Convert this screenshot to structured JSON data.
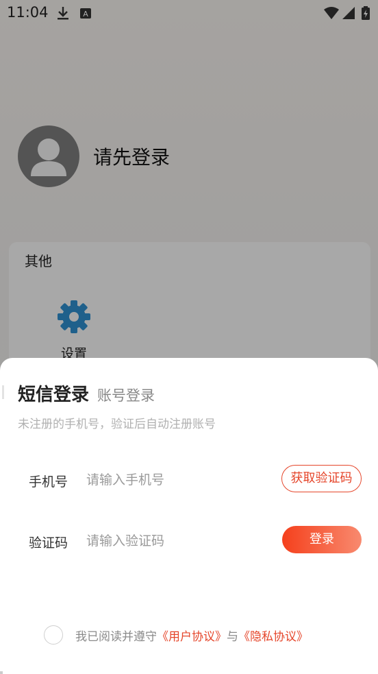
{
  "status_bar": {
    "time": "11:04",
    "icons": [
      "download-icon",
      "a-box-icon",
      "wifi-icon",
      "signal-icon",
      "battery-charging-icon"
    ]
  },
  "profile": {
    "name": "请先登录"
  },
  "other_section": {
    "title": "其他",
    "items": [
      {
        "label": "设置",
        "icon": "gear-icon"
      }
    ]
  },
  "login_sheet": {
    "tab_sms": "短信登录",
    "tab_account": "账号登录",
    "hint": "未注册的手机号，验证后自动注册账号",
    "phone_label": "手机号",
    "phone_placeholder": "请输入手机号",
    "phone_value": "",
    "get_code_label": "获取验证码",
    "code_label": "验证码",
    "code_placeholder": "请输入验证码",
    "code_value": "",
    "login_label": "登录",
    "agree_prefix": "我已阅读并遵守",
    "user_agreement": "《用户协议》",
    "and_text": "与",
    "privacy_agreement": "《隐私协议》",
    "agreed": false
  },
  "colors": {
    "accent": "#e5452a",
    "gear": "#2f8fd0"
  }
}
